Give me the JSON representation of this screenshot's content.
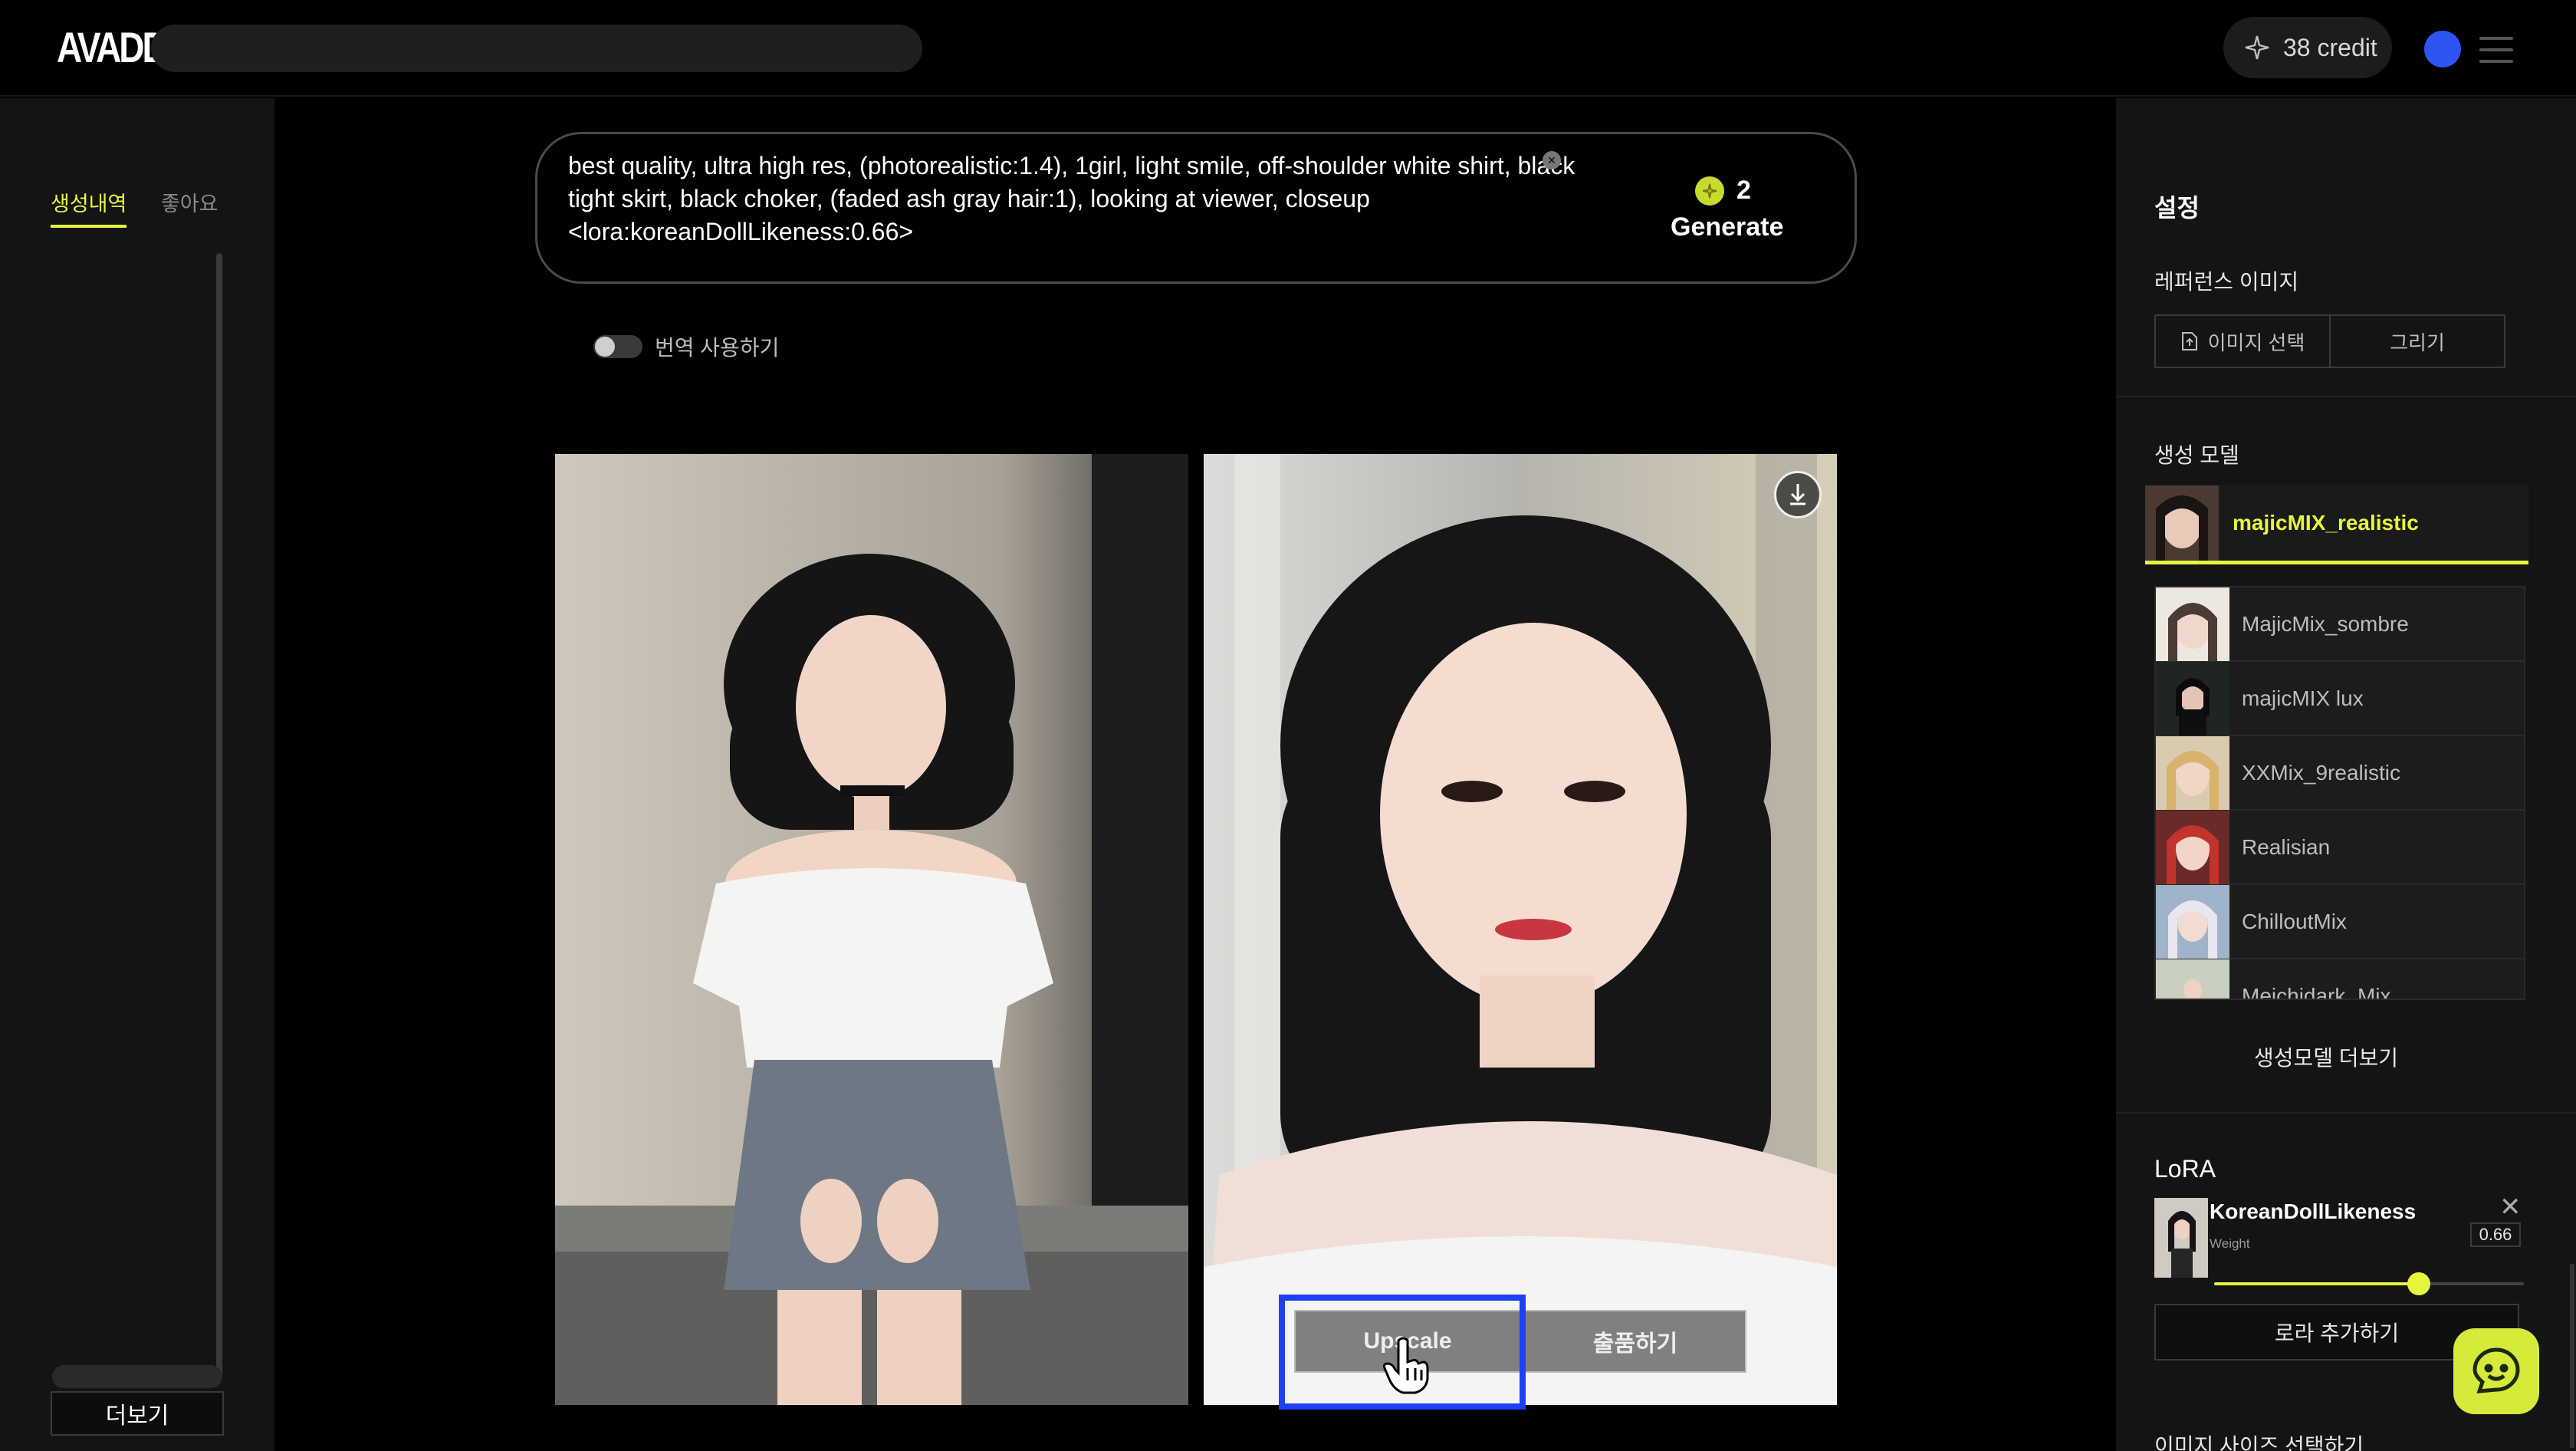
{
  "app": {
    "logo_text": "AVADDT"
  },
  "header": {
    "credit_text": "38 credit"
  },
  "left_sidebar": {
    "tabs": [
      {
        "label": "생성내역"
      },
      {
        "label": "좋아요"
      }
    ],
    "more_label": "더보기"
  },
  "prompt": {
    "text": "best quality, ultra high res, (photorealistic:1.4), 1girl, light smile, off-shoulder white shirt, black tight skirt, black choker, (faded ash gray hair:1), looking at viewer, closeup\n<lora:koreanDollLikeness:0.66>",
    "cost": "2",
    "generate_label": "Generate"
  },
  "translate": {
    "label": "번역 사용하기",
    "enabled": false
  },
  "image_actions": {
    "upscale_label": "Upscale",
    "publish_label": "출품하기"
  },
  "settings": {
    "title": "설정",
    "reference": {
      "label": "레퍼런스 이미지",
      "select_label": "이미지 선택",
      "draw_label": "그리기"
    },
    "model": {
      "label": "생성 모델",
      "selected": "majicMIX_realistic",
      "list": [
        {
          "name": "MajicMix_sombre"
        },
        {
          "name": "majicMIX lux"
        },
        {
          "name": "XXMix_9realistic"
        },
        {
          "name": "Realisian"
        },
        {
          "name": "ChilloutMix"
        },
        {
          "name": "Meichidark_Mix"
        }
      ],
      "more_label": "생성모델 더보기"
    },
    "lora": {
      "title": "LoRA",
      "name": "KoreanDollLikeness",
      "weight_label": "Weight",
      "weight_value": "0.66",
      "weight_fraction": 0.66,
      "add_label": "로라 추가하기"
    },
    "image_size_label": "이미지 사이즈 선택하기"
  },
  "colors": {
    "accent": "#e6f53d",
    "highlight": "#1f3ff5",
    "avatar": "#2e55f2"
  },
  "icons": [
    "sparkle-icon",
    "menu-icon",
    "download-icon",
    "upload-icon",
    "close-icon",
    "chat-icon",
    "hand-cursor-icon",
    "coin-icon"
  ]
}
